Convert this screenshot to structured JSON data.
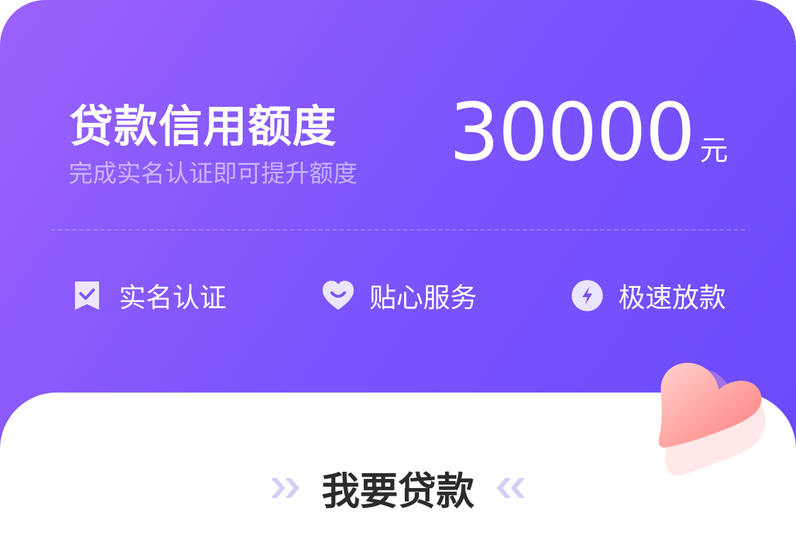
{
  "header": {
    "title": "贷款信用额度",
    "subtitle": "完成实名认证即可提升额度",
    "amount": "30000",
    "unit": "元"
  },
  "features": [
    {
      "label": "实名认证",
      "icon": "verified-badge-icon"
    },
    {
      "label": "贴心服务",
      "icon": "heart-icon"
    },
    {
      "label": "极速放款",
      "icon": "lightning-icon"
    }
  ],
  "section": {
    "title": "我要贷款"
  },
  "colors": {
    "gradient_start": "#9b62fb",
    "gradient_end": "#6a49fb",
    "heart": "#ff8f8f"
  }
}
